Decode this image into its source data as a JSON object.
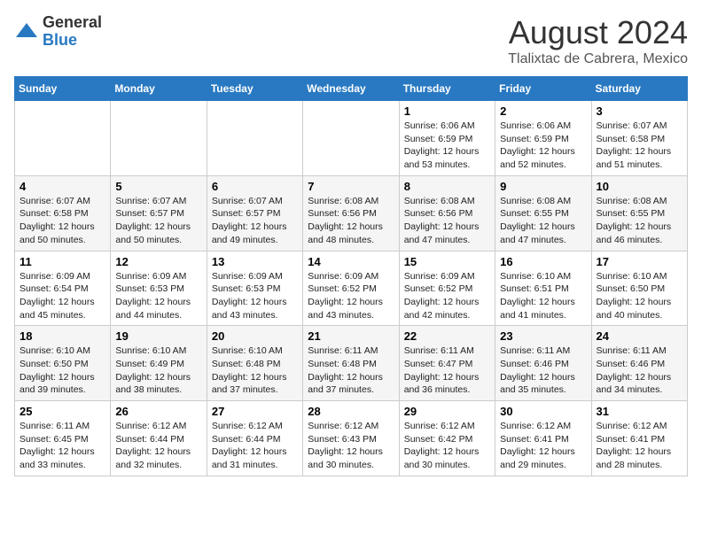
{
  "logo": {
    "general": "General",
    "blue": "Blue"
  },
  "title": "August 2024",
  "subtitle": "Tlalixtac de Cabrera, Mexico",
  "weekdays": [
    "Sunday",
    "Monday",
    "Tuesday",
    "Wednesday",
    "Thursday",
    "Friday",
    "Saturday"
  ],
  "weeks": [
    [
      {
        "day": "",
        "content": ""
      },
      {
        "day": "",
        "content": ""
      },
      {
        "day": "",
        "content": ""
      },
      {
        "day": "",
        "content": ""
      },
      {
        "day": "1",
        "content": "Sunrise: 6:06 AM\nSunset: 6:59 PM\nDaylight: 12 hours\nand 53 minutes."
      },
      {
        "day": "2",
        "content": "Sunrise: 6:06 AM\nSunset: 6:59 PM\nDaylight: 12 hours\nand 52 minutes."
      },
      {
        "day": "3",
        "content": "Sunrise: 6:07 AM\nSunset: 6:58 PM\nDaylight: 12 hours\nand 51 minutes."
      }
    ],
    [
      {
        "day": "4",
        "content": "Sunrise: 6:07 AM\nSunset: 6:58 PM\nDaylight: 12 hours\nand 50 minutes."
      },
      {
        "day": "5",
        "content": "Sunrise: 6:07 AM\nSunset: 6:57 PM\nDaylight: 12 hours\nand 50 minutes."
      },
      {
        "day": "6",
        "content": "Sunrise: 6:07 AM\nSunset: 6:57 PM\nDaylight: 12 hours\nand 49 minutes."
      },
      {
        "day": "7",
        "content": "Sunrise: 6:08 AM\nSunset: 6:56 PM\nDaylight: 12 hours\nand 48 minutes."
      },
      {
        "day": "8",
        "content": "Sunrise: 6:08 AM\nSunset: 6:56 PM\nDaylight: 12 hours\nand 47 minutes."
      },
      {
        "day": "9",
        "content": "Sunrise: 6:08 AM\nSunset: 6:55 PM\nDaylight: 12 hours\nand 47 minutes."
      },
      {
        "day": "10",
        "content": "Sunrise: 6:08 AM\nSunset: 6:55 PM\nDaylight: 12 hours\nand 46 minutes."
      }
    ],
    [
      {
        "day": "11",
        "content": "Sunrise: 6:09 AM\nSunset: 6:54 PM\nDaylight: 12 hours\nand 45 minutes."
      },
      {
        "day": "12",
        "content": "Sunrise: 6:09 AM\nSunset: 6:53 PM\nDaylight: 12 hours\nand 44 minutes."
      },
      {
        "day": "13",
        "content": "Sunrise: 6:09 AM\nSunset: 6:53 PM\nDaylight: 12 hours\nand 43 minutes."
      },
      {
        "day": "14",
        "content": "Sunrise: 6:09 AM\nSunset: 6:52 PM\nDaylight: 12 hours\nand 43 minutes."
      },
      {
        "day": "15",
        "content": "Sunrise: 6:09 AM\nSunset: 6:52 PM\nDaylight: 12 hours\nand 42 minutes."
      },
      {
        "day": "16",
        "content": "Sunrise: 6:10 AM\nSunset: 6:51 PM\nDaylight: 12 hours\nand 41 minutes."
      },
      {
        "day": "17",
        "content": "Sunrise: 6:10 AM\nSunset: 6:50 PM\nDaylight: 12 hours\nand 40 minutes."
      }
    ],
    [
      {
        "day": "18",
        "content": "Sunrise: 6:10 AM\nSunset: 6:50 PM\nDaylight: 12 hours\nand 39 minutes."
      },
      {
        "day": "19",
        "content": "Sunrise: 6:10 AM\nSunset: 6:49 PM\nDaylight: 12 hours\nand 38 minutes."
      },
      {
        "day": "20",
        "content": "Sunrise: 6:10 AM\nSunset: 6:48 PM\nDaylight: 12 hours\nand 37 minutes."
      },
      {
        "day": "21",
        "content": "Sunrise: 6:11 AM\nSunset: 6:48 PM\nDaylight: 12 hours\nand 37 minutes."
      },
      {
        "day": "22",
        "content": "Sunrise: 6:11 AM\nSunset: 6:47 PM\nDaylight: 12 hours\nand 36 minutes."
      },
      {
        "day": "23",
        "content": "Sunrise: 6:11 AM\nSunset: 6:46 PM\nDaylight: 12 hours\nand 35 minutes."
      },
      {
        "day": "24",
        "content": "Sunrise: 6:11 AM\nSunset: 6:46 PM\nDaylight: 12 hours\nand 34 minutes."
      }
    ],
    [
      {
        "day": "25",
        "content": "Sunrise: 6:11 AM\nSunset: 6:45 PM\nDaylight: 12 hours\nand 33 minutes."
      },
      {
        "day": "26",
        "content": "Sunrise: 6:12 AM\nSunset: 6:44 PM\nDaylight: 12 hours\nand 32 minutes."
      },
      {
        "day": "27",
        "content": "Sunrise: 6:12 AM\nSunset: 6:44 PM\nDaylight: 12 hours\nand 31 minutes."
      },
      {
        "day": "28",
        "content": "Sunrise: 6:12 AM\nSunset: 6:43 PM\nDaylight: 12 hours\nand 30 minutes."
      },
      {
        "day": "29",
        "content": "Sunrise: 6:12 AM\nSunset: 6:42 PM\nDaylight: 12 hours\nand 30 minutes."
      },
      {
        "day": "30",
        "content": "Sunrise: 6:12 AM\nSunset: 6:41 PM\nDaylight: 12 hours\nand 29 minutes."
      },
      {
        "day": "31",
        "content": "Sunrise: 6:12 AM\nSunset: 6:41 PM\nDaylight: 12 hours\nand 28 minutes."
      }
    ]
  ]
}
